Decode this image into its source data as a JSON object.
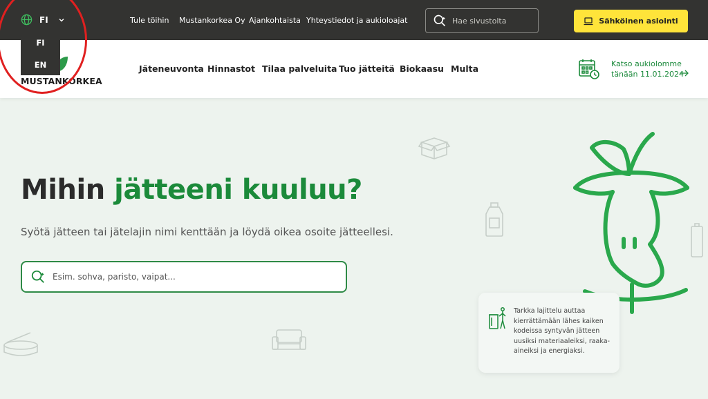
{
  "topbar": {
    "language": "FI",
    "language_options": [
      "FI",
      "EN"
    ],
    "links": [
      "Tule töihin",
      "Mustankorkea Oy",
      "Ajankohtaista",
      "Yhteystiedot ja aukioloajat"
    ],
    "search_placeholder": "Hae sivustolta",
    "eservice_label": "Sähköinen asiointi"
  },
  "header": {
    "logo_text": "MUSTANKORKEA",
    "nav": [
      "Jäteneuvonta",
      "Hinnastot",
      "Tilaa palveluita",
      "Tuo jätteitä",
      "Biokaasu",
      "Multa"
    ],
    "hours_line1": "Katso aukiolomme",
    "hours_line2": "tänään 11.01.2024"
  },
  "hero": {
    "title_part1": "Mihin ",
    "title_part2": "jätteeni kuuluu?",
    "subtitle": "Syötä jätteen tai jätelajin nimi kenttään ja löydä oikea osoite jätteellesi.",
    "search_placeholder": "Esim. sohva, paristo, vaipat..."
  },
  "info_card": {
    "text": "Tarkka lajittelu auttaa kierrättämään lähes kaiken kodeissa syntyvän jätteen uusiksi materiaaleiksi, raaka-aineiksi ja energiaksi."
  },
  "colors": {
    "brand_green": "#1b8a3a",
    "topbar_bg": "#333331",
    "accent_yellow": "#ffe43a",
    "hero_bg": "#edf3ee",
    "annotation_red": "#e02020"
  }
}
